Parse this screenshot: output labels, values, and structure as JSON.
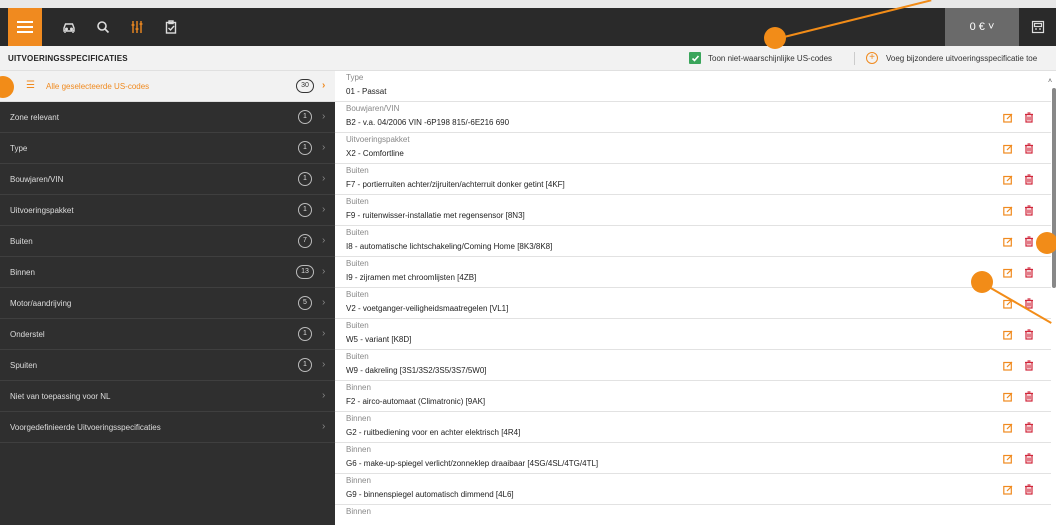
{
  "topbar": {
    "icons": [
      "menu-icon",
      "car-icon",
      "search-icon",
      "specs-icon",
      "clipboard-icon"
    ],
    "price": "0 € ˅"
  },
  "header": {
    "title": "UITVOERINGSSPECIFICATIES",
    "toggle_label": "Toon niet-waarschijnlijke US-codes",
    "add_label": "Voeg bijzondere uitvoeringsspecificatie toe"
  },
  "sidebar": {
    "items": [
      {
        "label": "Alle geselecteerde US-codes",
        "count": "30",
        "active": true
      },
      {
        "label": "Zone relevant",
        "count": "1"
      },
      {
        "label": "Type",
        "count": "1"
      },
      {
        "label": "Bouwjaren/VIN",
        "count": "1"
      },
      {
        "label": "Uitvoeringspakket",
        "count": "1"
      },
      {
        "label": "Buiten",
        "count": "7"
      },
      {
        "label": "Binnen",
        "count": "13"
      },
      {
        "label": "Motor/aandrijving",
        "count": "5"
      },
      {
        "label": "Onderstel",
        "count": "1"
      },
      {
        "label": "Spuiten",
        "count": "1"
      },
      {
        "label": "Niet van toepassing voor NL",
        "count": ""
      },
      {
        "label": "Voorgedefinieerde Uitvoeringsspecificaties",
        "count": ""
      }
    ]
  },
  "rows": [
    {
      "cat": "Type",
      "val": "01 - Passat",
      "actions": false
    },
    {
      "cat": "Bouwjaren/VIN",
      "val": "B2 - v.a. 04/2006 VIN -6P198 815/-6E216 690",
      "actions": true
    },
    {
      "cat": "Uitvoeringspakket",
      "val": "X2 - Comfortline",
      "actions": true
    },
    {
      "cat": "Buiten",
      "val": "F7 - portierruiten achter/zijruiten/achterruit donker getint [4KF]",
      "actions": true
    },
    {
      "cat": "Buiten",
      "val": "F9 - ruitenwisser-installatie met regensensor [8N3]",
      "actions": true
    },
    {
      "cat": "Buiten",
      "val": "I8 - automatische lichtschakeling/Coming Home [8K3/8K8]",
      "actions": true
    },
    {
      "cat": "Buiten",
      "val": "I9 - zijramen met chroomlijsten [4ZB]",
      "actions": true
    },
    {
      "cat": "Buiten",
      "val": "V2 - voetganger-veiligheidsmaatregelen [VL1]",
      "actions": true
    },
    {
      "cat": "Buiten",
      "val": "W5 - variant [K8D]",
      "actions": true
    },
    {
      "cat": "Buiten",
      "val": "W9 - dakreling [3S1/3S2/3S5/3S7/5W0]",
      "actions": true
    },
    {
      "cat": "Binnen",
      "val": "F2 - airco-automaat (Climatronic) [9AK]",
      "actions": true
    },
    {
      "cat": "Binnen",
      "val": "G2 - ruitbediening voor en achter elektrisch [4R4]",
      "actions": true
    },
    {
      "cat": "Binnen",
      "val": "G6 - make-up-spiegel verlicht/zonneklep draaibaar [4SG/4SL/4TG/4TL]",
      "actions": true
    },
    {
      "cat": "Binnen",
      "val": "G9 - binnenspiegel automatisch dimmend [4L6]",
      "actions": true
    },
    {
      "cat": "Binnen",
      "val": "",
      "actions": false
    }
  ],
  "colors": {
    "accent": "#f08a1f",
    "topbar": "#2a2a2a",
    "sidebar": "#2f2f2f",
    "check": "#3aa55b",
    "delete": "#d0263a"
  }
}
